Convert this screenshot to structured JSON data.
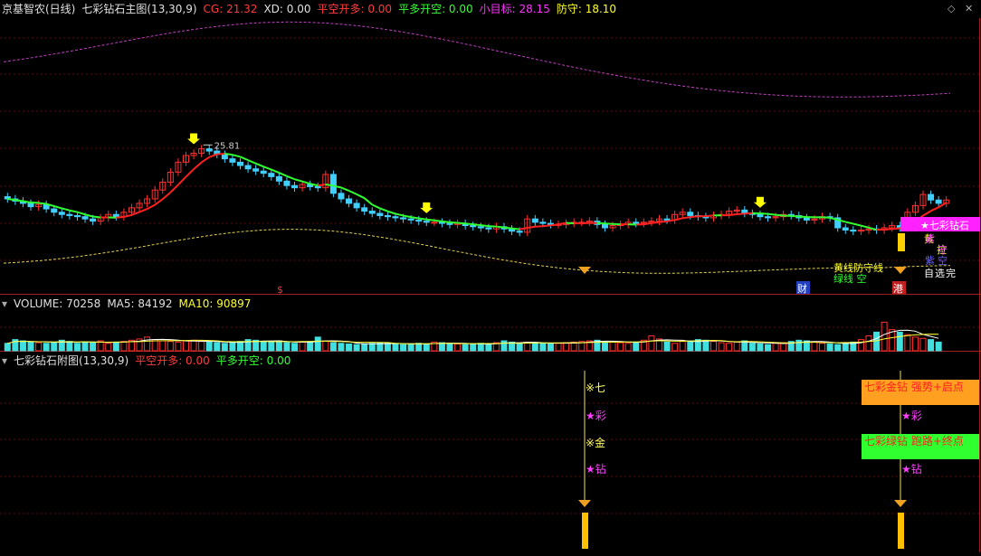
{
  "main_header": {
    "stock": "京基智农(日线)",
    "indicator": "七彩钻石主图(13,30,9)",
    "items": [
      {
        "label": "CG: 21.32",
        "color": "#ff3c3c"
      },
      {
        "label": "XD: 0.00",
        "color": "#e0e0e0"
      },
      {
        "label": "平空开多: 0.00",
        "color": "#ff3c3c"
      },
      {
        "label": "平多开空: 0.00",
        "color": "#33ff33"
      },
      {
        "label": "小目标: 28.15",
        "color": "#ff33ff"
      },
      {
        "label": "防守: 18.10",
        "color": "#ffff33"
      }
    ]
  },
  "volume_header": {
    "items": [
      {
        "label": "VOLUME: 70258",
        "color": "#e0e0e0"
      },
      {
        "label": "MA5: 84192",
        "color": "#e0e0e0"
      },
      {
        "label": "MA10: 90897",
        "color": "#ffff33"
      }
    ]
  },
  "sub_header": {
    "indicator": "七彩钻石附图(13,30,9)",
    "items": [
      {
        "label": "平空开多: 0.00",
        "color": "#ff3c3c"
      },
      {
        "label": "平多开空: 0.00",
        "color": "#33ff33"
      }
    ]
  },
  "chart_data": {
    "type": "candlestick",
    "high_label": "25.81",
    "price_range": [
      14.5,
      27.5
    ],
    "closes": [
      21.0,
      20.8,
      20.6,
      20.3,
      20.5,
      20.1,
      19.8,
      19.6,
      19.5,
      19.4,
      19.2,
      19.0,
      19.3,
      19.6,
      19.4,
      19.8,
      20.2,
      20.6,
      21.0,
      21.8,
      22.5,
      23.4,
      24.3,
      24.9,
      25.1,
      25.5,
      25.3,
      25.0,
      24.6,
      24.3,
      24.0,
      23.7,
      23.5,
      23.3,
      23.0,
      22.6,
      22.2,
      22.0,
      22.3,
      22.1,
      22.0,
      23.2,
      21.5,
      21.0,
      20.6,
      20.2,
      19.9,
      19.7,
      19.5,
      19.4,
      19.3,
      19.2,
      19.1,
      19.0,
      18.9,
      18.9,
      18.8,
      18.7,
      18.8,
      18.6,
      18.5,
      18.4,
      18.3,
      18.5,
      18.3,
      18.1,
      18.0,
      19.2,
      18.9,
      18.8,
      18.7,
      18.7,
      18.8,
      18.9,
      18.9,
      19.0,
      18.7,
      18.4,
      18.6,
      18.7,
      18.9,
      18.8,
      18.9,
      19.0,
      19.2,
      19.1,
      19.6,
      19.8,
      19.5,
      19.4,
      19.3,
      19.5,
      19.6,
      19.9,
      20.0,
      19.7,
      19.6,
      19.4,
      19.3,
      19.4,
      19.6,
      19.5,
      19.3,
      19.1,
      19.2,
      19.4,
      19.3,
      18.4,
      18.2,
      18.1,
      18.2,
      18.3,
      18.2,
      18.4,
      18.6,
      18.4,
      19.8,
      20.4,
      21.4,
      20.9,
      20.6,
      20.9
    ],
    "volume_range": [
      0,
      320000
    ],
    "volumes": [
      60000,
      90000,
      80000,
      70000,
      65000,
      60000,
      70000,
      85000,
      75000,
      60000,
      70000,
      65000,
      80000,
      60000,
      70000,
      75000,
      85000,
      95000,
      110000,
      90000,
      80000,
      75000,
      70000,
      80000,
      85000,
      75000,
      70000,
      65000,
      60000,
      70000,
      75000,
      90000,
      85000,
      70000,
      75000,
      80000,
      65000,
      60000,
      70000,
      75000,
      110000,
      80000,
      65000,
      60000,
      55000,
      50000,
      55000,
      60000,
      65000,
      60000,
      55000,
      50000,
      55000,
      60000,
      55000,
      70000,
      65000,
      60000,
      55000,
      50000,
      55000,
      60000,
      50000,
      65000,
      80000,
      70000,
      60000,
      70000,
      65000,
      60000,
      55000,
      60000,
      65000,
      70000,
      75000,
      80000,
      85000,
      75000,
      70000,
      65000,
      60000,
      70000,
      85000,
      120000,
      95000,
      70000,
      60000,
      75000,
      80000,
      90000,
      85000,
      75000,
      65000,
      60000,
      70000,
      80000,
      60000,
      55000,
      50000,
      60000,
      65000,
      75000,
      85000,
      80000,
      70000,
      60000,
      55000,
      50000,
      60000,
      70000,
      90000,
      120000,
      150000,
      230000,
      170000,
      150000,
      130000,
      110000,
      100000,
      90000,
      70258
    ]
  },
  "main_labels": {
    "top_box": "★七彩钻石",
    "seq": [
      "黄",
      "拉",
      "紫",
      "守",
      "紫",
      "空",
      "自",
      "选",
      "完"
    ],
    "tag_dollar": "$",
    "tag_cai": "财",
    "tag_gang": "港",
    "mid_text": "黄线防守线",
    "green_text": "绿线 空"
  },
  "sub_labels": {
    "a1": "※七",
    "a2": "★彩",
    "a3": "※金",
    "a4": "★钻",
    "b1": "★彩",
    "b2": "★钻",
    "box1": "七彩金钻 强势+启点",
    "box2": "七彩绿钻 跑路+终点"
  }
}
